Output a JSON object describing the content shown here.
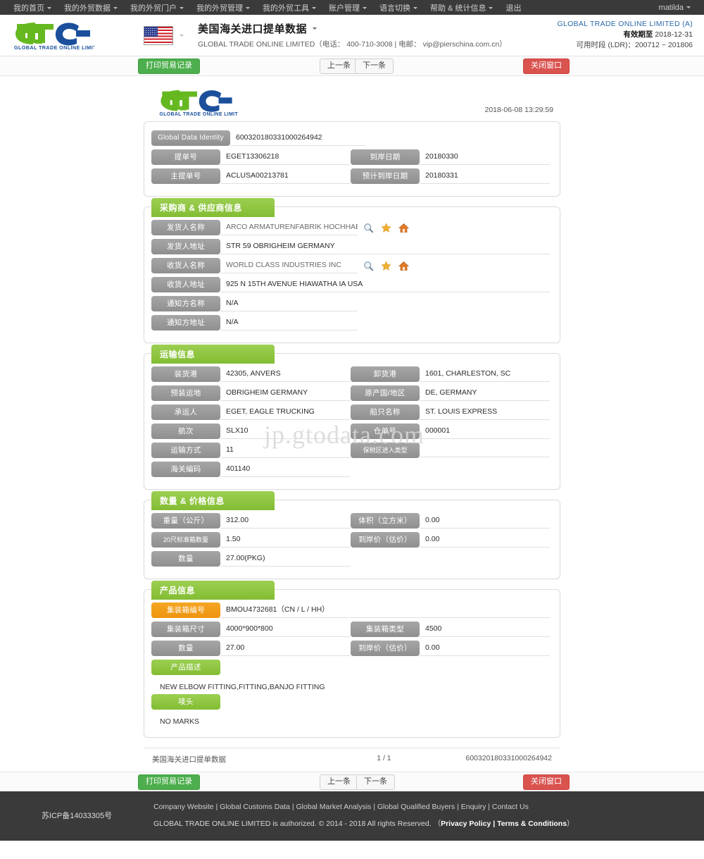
{
  "topnav": {
    "items": [
      {
        "label": "我的首页",
        "caret": true
      },
      {
        "label": "我的外贸数据",
        "caret": true
      },
      {
        "label": "我的外贸门户",
        "caret": true
      },
      {
        "label": "我的外贸管理",
        "caret": true
      },
      {
        "label": "我的外贸工具",
        "caret": true
      },
      {
        "label": "账户管理",
        "caret": true
      },
      {
        "label": "语言切换",
        "caret": true
      },
      {
        "label": "帮助 & 统计信息",
        "caret": true
      },
      {
        "label": "退出",
        "caret": false
      }
    ],
    "user": "matilda"
  },
  "header": {
    "logo_text": "GLOBAL TRADE ONLINE LIMITED",
    "flag": "us-flag-icon",
    "title": "美国海关进口提单数据",
    "subtitle": "GLOBAL TRADE ONLINE LIMITED（电话： 400-710-3008 | 电邮： vip@pierschina.com.cn）",
    "account": "GLOBAL TRADE ONLINE LIMITED (A)",
    "valid_label": "有效期至",
    "valid_date": "2018-12-31",
    "range_label": "可用时段 (LDR)：",
    "range_value": "200712 ~ 201806"
  },
  "toolbar": {
    "print_label": "打印贸易记录",
    "prev_label": "上一条",
    "next_label": "下一条",
    "close_label": "关闭窗口"
  },
  "document": {
    "timestamp": "2018-06-08 13:29:59",
    "watermark": "jp.gtodata.com",
    "identity": {
      "label": "Global Data Identity",
      "value": "600320180331000264942"
    },
    "basic": [
      {
        "label": "提单号",
        "value": "EGET13306218",
        "label2": "到岸日期",
        "value2": "20180330"
      },
      {
        "label": "主提单号",
        "value": "ACLUSA00213781",
        "label2": "预计到岸日期",
        "value2": "20180331"
      }
    ],
    "parties": {
      "title": "采购商 & 供应商信息",
      "rows": [
        {
          "label": "发货人名称",
          "value": "ARCO ARMATURENFABRIK HOCHHAEUSER",
          "icons": true
        },
        {
          "label": "发货人地址",
          "value": "STR 59 OBRIGHEIM GERMANY",
          "icons": false
        },
        {
          "label": "收货人名称",
          "value": "WORLD CLASS INDUSTRIES INC",
          "icons": true
        },
        {
          "label": "收货人地址",
          "value": "925 N 15TH AVENUE HIAWATHA IA USA",
          "icons": false
        },
        {
          "label": "通知方名称",
          "value": "N/A",
          "icons": false
        },
        {
          "label": "通知方地址",
          "value": "N/A",
          "icons": false
        }
      ],
      "icon_names": [
        "search-icon",
        "star-icon",
        "home-icon"
      ]
    },
    "transport": {
      "title": "运输信息",
      "rows": [
        {
          "label": "装货港",
          "value": "42305, ANVERS",
          "label2": "卸货港",
          "value2": "1601, CHARLESTON, SC"
        },
        {
          "label": "预装运地",
          "value": "OBRIGHEIM GERMANY",
          "label2": "原产国/地区",
          "value2": "DE, GERMANY"
        },
        {
          "label": "承运人",
          "value": "EGET, EAGLE TRUCKING",
          "label2": "船只名称",
          "value2": "ST. LOUIS EXPRESS"
        },
        {
          "label": "航次",
          "value": "SLX10",
          "label2": "仓单号",
          "value2": "000001"
        },
        {
          "label": "运输方式",
          "value": "11",
          "label2": "保税区进入类型",
          "value2": ""
        },
        {
          "label": "海关编码",
          "value": "401140",
          "label2": "",
          "value2": ""
        }
      ]
    },
    "quantity": {
      "title": "数量 & 价格信息",
      "rows": [
        {
          "label": "重量（公斤）",
          "value": "312.00",
          "label2": "体积（立方米）",
          "value2": "0.00"
        },
        {
          "label": "20尺标准箱数量",
          "value": "1.50",
          "label2": "到岸价（估价）",
          "value2": "0.00"
        },
        {
          "label": "数量",
          "value": "27.00(PKG)",
          "label2": "",
          "value2": ""
        }
      ]
    },
    "product": {
      "title": "产品信息",
      "container_label": "集装箱编号",
      "container_value": "BMOU4732681（CN / L / HH）",
      "rows": [
        {
          "label": "集装箱尺寸",
          "value": "4000*900*800",
          "label2": "集装箱类型",
          "value2": "4500"
        },
        {
          "label": "数量",
          "value": "27.00",
          "label2": "到岸价（估价）",
          "value2": "0.00"
        }
      ],
      "desc_label": "产品描述",
      "desc_value": "NEW ELBOW FITTING,FITTING,BANJO FITTING",
      "marks_label": "唛头",
      "marks_value": "NO MARKS"
    },
    "footer": {
      "source": "美国海关进口提单数据",
      "page": "1 / 1",
      "identity": "600320180331000264942"
    }
  },
  "footer": {
    "icp": "苏ICP备14033305号",
    "links": "Company Website | Global Customs Data | Global Market Analysis | Global Qualified Buyers | Enquiry | Contact Us",
    "copyright_pre": "GLOBAL TRADE ONLINE LIMITED is authorized. © 2014 - 2018 All rights Reserved. （",
    "copyright_bold": "Privacy Policy | Terms & Conditions",
    "copyright_post": "）"
  },
  "colors": {
    "nav_bg": "#3a3a3a",
    "green": "#8dc63f",
    "gray_label": "#9a9a9a",
    "orange": "#f5a623",
    "btn_green": "#4cae4c",
    "btn_red": "#d9534f",
    "accent_blue": "#2c6aa8"
  }
}
